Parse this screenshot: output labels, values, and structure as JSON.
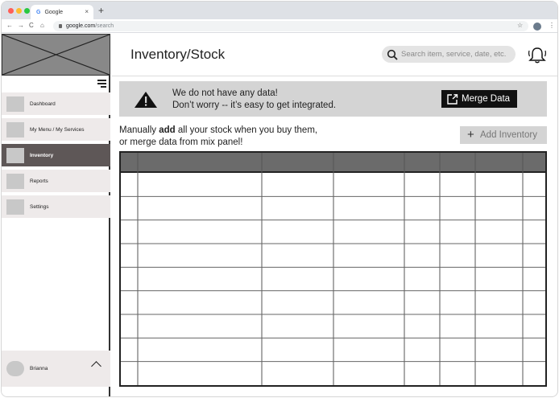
{
  "browser": {
    "tab_title": "Google",
    "tab_icon": "G",
    "tab_close": "×",
    "new_tab": "+",
    "url_host": "google.com",
    "url_path": "/search"
  },
  "sidebar": {
    "items": [
      {
        "label": "Dashboard",
        "active": false
      },
      {
        "label": "My Menu / My Services",
        "active": false
      },
      {
        "label": "Inventory",
        "active": true
      },
      {
        "label": "Reports",
        "active": false
      },
      {
        "label": "Settings",
        "active": false
      }
    ],
    "user_name": "Brianna"
  },
  "header": {
    "title": "Inventory/Stock",
    "search_placeholder": "Search item, service, date, etc."
  },
  "banner": {
    "line1": "We do not have any data!",
    "line2": "Don’t worry -- it’s easy to get integrated.",
    "merge_label": "Merge Data"
  },
  "instructions": {
    "pre": "Manually ",
    "bold": "add",
    "post": " all your stock when you buy them,",
    "line2": "or merge data from mix panel!"
  },
  "add_inventory_label": "Add Inventory",
  "table": {
    "columns": [
      "",
      "",
      "",
      "",
      "",
      "",
      "",
      ""
    ],
    "rows": 9
  },
  "colors": {
    "active_nav": "#5e5757",
    "nav_bg": "#eeeaea",
    "banner_bg": "#d4d4d4",
    "table_header": "#6b6b6b"
  }
}
